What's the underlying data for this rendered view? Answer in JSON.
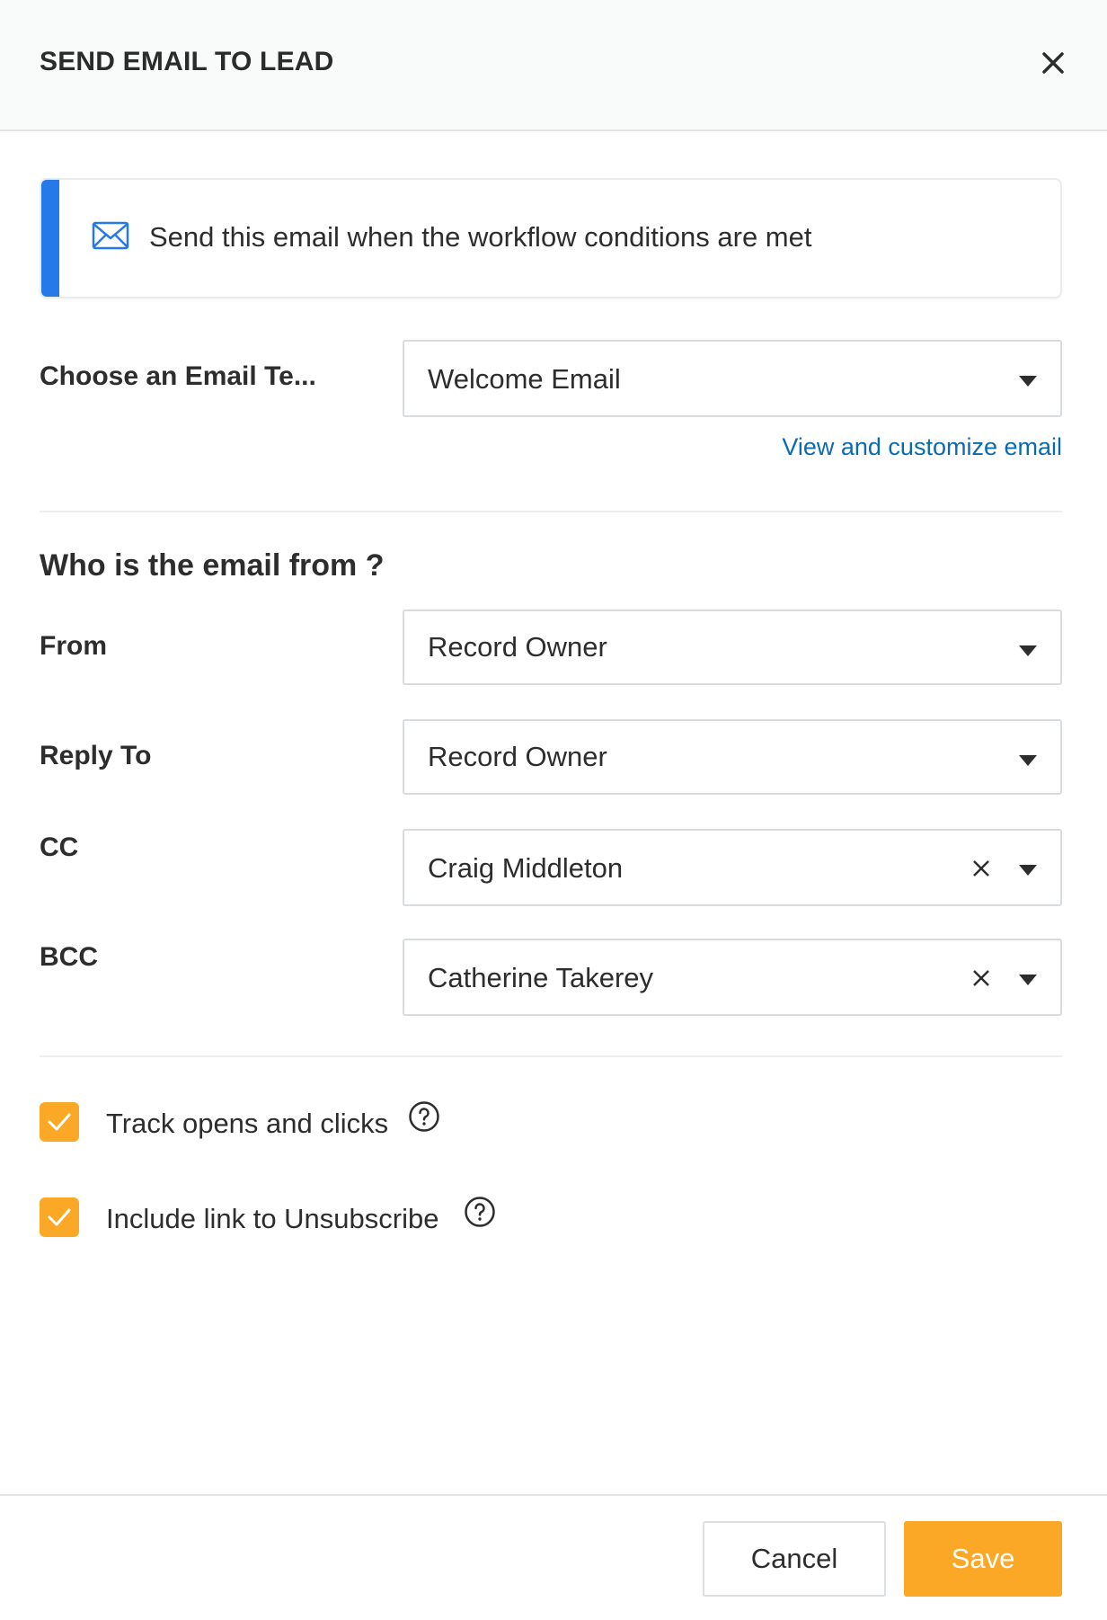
{
  "header": {
    "title": "SEND EMAIL TO LEAD"
  },
  "info": {
    "text": "Send this email when the workflow conditions are met",
    "accent_color": "#2579e8",
    "icon": "mail-icon"
  },
  "template": {
    "label": "Choose an Email Te...",
    "selected": "Welcome Email",
    "link_text": "View and customize email"
  },
  "from_section": {
    "title": "Who is the email from ?",
    "fields": [
      {
        "label": "From",
        "value": "Record Owner",
        "clearable": false
      },
      {
        "label": "Reply To",
        "value": "Record Owner",
        "clearable": false
      },
      {
        "label": "CC",
        "value": "Craig Middleton",
        "clearable": true
      },
      {
        "label": "BCC",
        "value": "Catherine Takerey",
        "clearable": true
      }
    ]
  },
  "options": [
    {
      "label": "Track opens and clicks",
      "checked": true
    },
    {
      "label": "Include link to Unsubscribe",
      "checked": true
    }
  ],
  "footer": {
    "cancel_label": "Cancel",
    "save_label": "Save"
  },
  "colors": {
    "primary": "#fba826",
    "link": "#0a6bb0"
  }
}
